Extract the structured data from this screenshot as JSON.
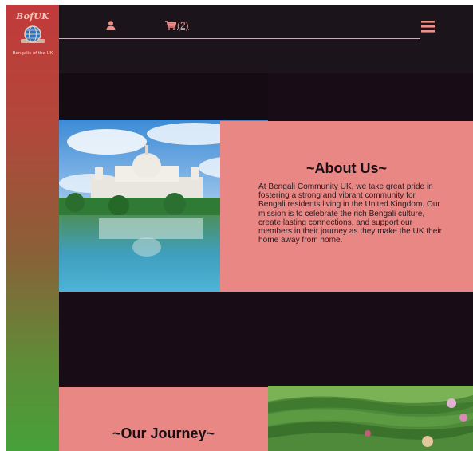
{
  "logo": {
    "name": "BofUK",
    "tagline": "Bengalis of the UK"
  },
  "header": {
    "cart_count": "(2)",
    "user_icon": "user-icon",
    "cart_icon": "cart-icon",
    "menu_icon": "hamburger-menu-icon"
  },
  "about": {
    "title": "~About Us~",
    "text": "At Bengali Community UK, we take great pride in fostering a strong and vibrant community for Bengali residents living in the United Kingdom. Our mission is to celebrate the rich Bengali culture, create lasting connections, and support our members in their journey as they make the UK their home away from home."
  },
  "journey": {
    "title": "~Our Journey~",
    "text": "..."
  },
  "colors": {
    "accent": "#e88783",
    "dark_bg": "#180d16",
    "sidebar_top": "#c23a3b",
    "sidebar_bottom": "#46a13a",
    "cart_link": "#f08f8a"
  }
}
